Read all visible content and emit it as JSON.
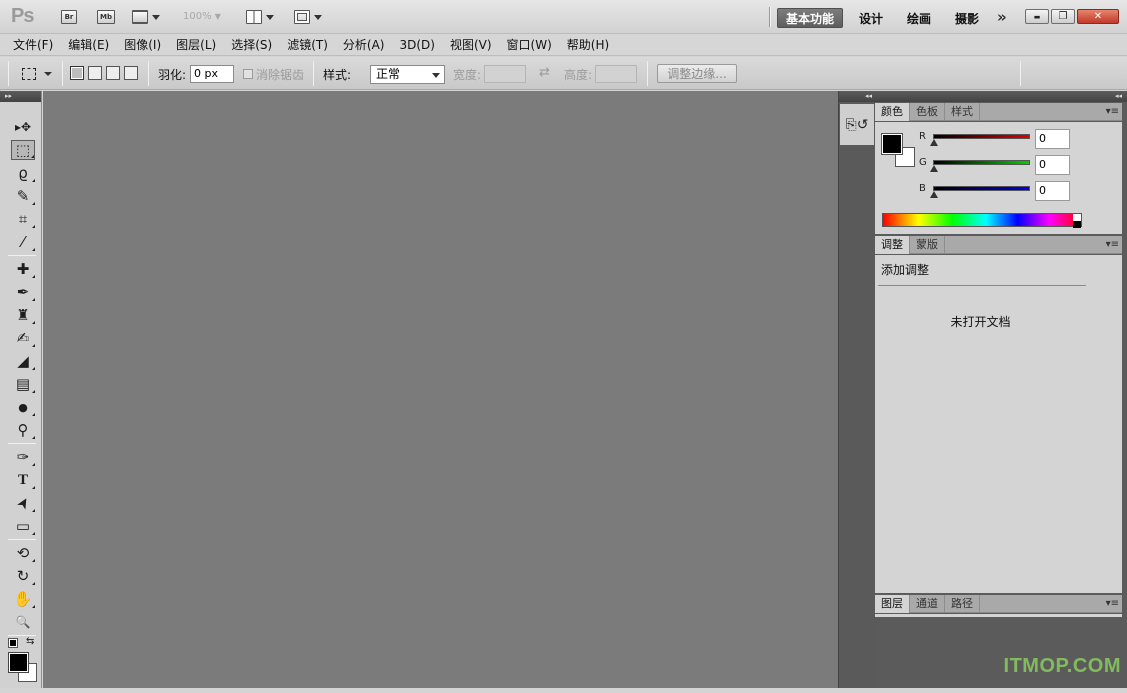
{
  "app": {
    "logo": "Ps",
    "bridge_label": "Br",
    "mini_bridge_label": "Mb",
    "zoom_level": "100%"
  },
  "workspaces": {
    "items": [
      "基本功能",
      "设计",
      "绘画",
      "摄影"
    ],
    "active": "基本功能",
    "more_glyph": "»"
  },
  "window_controls": {
    "minimize": "▬",
    "maximize": "❐",
    "close": "✕"
  },
  "menu": [
    "文件(F)",
    "编辑(E)",
    "图像(I)",
    "图层(L)",
    "选择(S)",
    "滤镜(T)",
    "分析(A)",
    "3D(D)",
    "视图(V)",
    "窗口(W)",
    "帮助(H)"
  ],
  "options_bar": {
    "feather_label": "羽化:",
    "feather_value": "0 px",
    "anti_alias_label": "消除锯齿",
    "style_label": "样式:",
    "style_value": "正常",
    "width_label": "宽度:",
    "height_label": "高度:",
    "swap_glyph": "⇄",
    "refine_edge": "调整边缘..."
  },
  "tools": [
    {
      "name": "move-tool",
      "glyph": "▸✥"
    },
    {
      "name": "rectangular-marquee-tool",
      "glyph": "⬚"
    },
    {
      "name": "lasso-tool",
      "glyph": "ϱ"
    },
    {
      "name": "quick-selection-tool",
      "glyph": "✎"
    },
    {
      "name": "crop-tool",
      "glyph": "⌗"
    },
    {
      "name": "eyedropper-tool",
      "glyph": "⁄"
    },
    {
      "name": "spot-healing-brush-tool",
      "glyph": "✚"
    },
    {
      "name": "brush-tool",
      "glyph": "✒"
    },
    {
      "name": "clone-stamp-tool",
      "glyph": "♜"
    },
    {
      "name": "history-brush-tool",
      "glyph": "✍"
    },
    {
      "name": "eraser-tool",
      "glyph": "◢"
    },
    {
      "name": "gradient-tool",
      "glyph": "▤"
    },
    {
      "name": "blur-tool",
      "glyph": "●"
    },
    {
      "name": "dodge-tool",
      "glyph": "⚲"
    },
    {
      "name": "pen-tool",
      "glyph": "✑"
    },
    {
      "name": "type-tool",
      "glyph": "T"
    },
    {
      "name": "path-selection-tool",
      "glyph": "➤"
    },
    {
      "name": "rectangle-tool",
      "glyph": "▭"
    },
    {
      "name": "3d-rotate-tool",
      "glyph": "⟲"
    },
    {
      "name": "3d-orbit-tool",
      "glyph": "↻"
    },
    {
      "name": "hand-tool",
      "glyph": "✋"
    },
    {
      "name": "zoom-tool",
      "glyph": "🔍"
    }
  ],
  "color_panel": {
    "tabs": [
      "颜色",
      "色板",
      "样式"
    ],
    "channels": [
      {
        "letter": "R",
        "value": "0",
        "color": "#e00000"
      },
      {
        "letter": "G",
        "value": "0",
        "color": "#00d000"
      },
      {
        "letter": "B",
        "value": "0",
        "color": "#0000e0"
      }
    ]
  },
  "adjustments_panel": {
    "tabs": [
      "调整",
      "蒙版"
    ],
    "heading": "添加调整",
    "empty_message": "未打开文档"
  },
  "layers_panel": {
    "tabs": [
      "图层",
      "通道",
      "路径"
    ]
  },
  "panel_menu_glyph": "▾≡",
  "dock_collapse_glyph": "◂◂",
  "dock_expand_glyph": "▸▸",
  "watermark": "ITMOP.COM"
}
